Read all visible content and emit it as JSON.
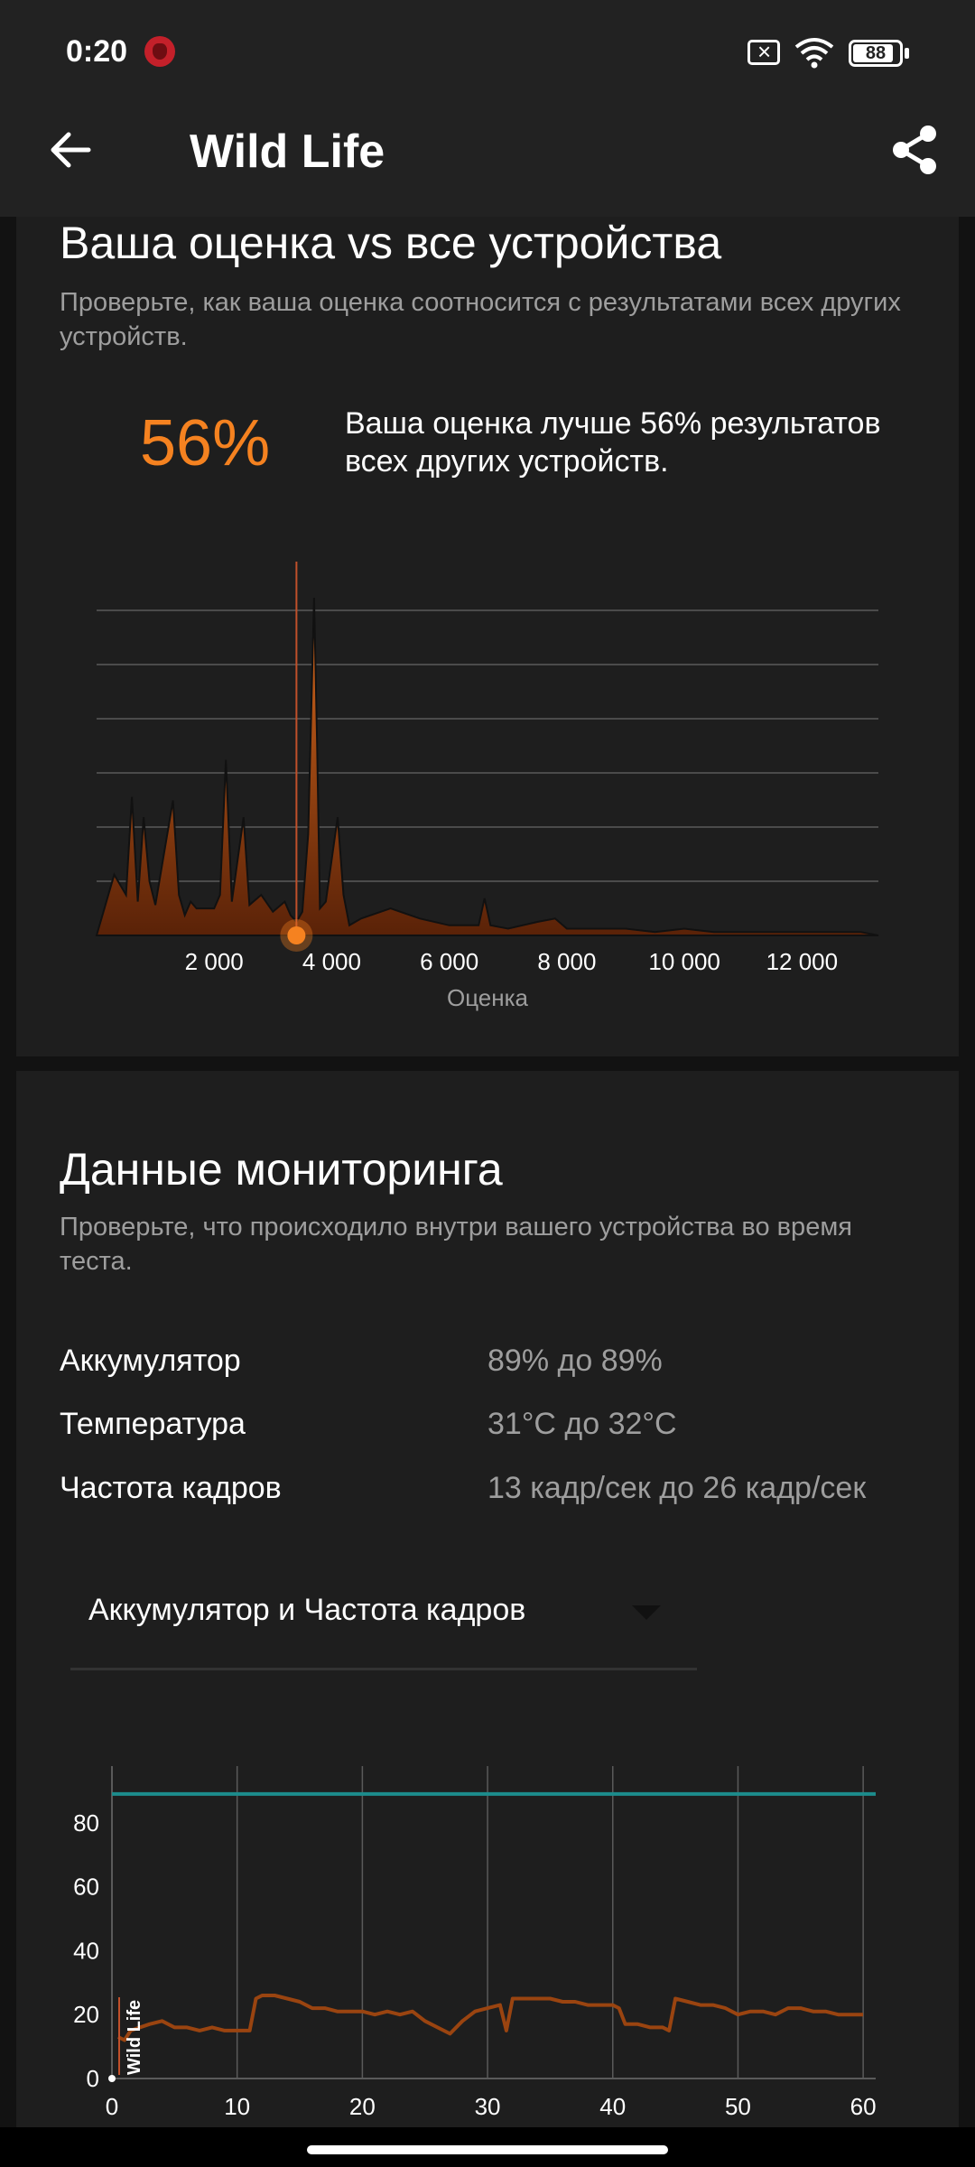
{
  "status_bar": {
    "time": "0:20",
    "battery_level": "88"
  },
  "app_bar": {
    "title": "Wild Life"
  },
  "comparison": {
    "title": "Ваша оценка vs все устройства",
    "subtitle": "Проверьте, как ваша оценка соотносится с результатами всех других устройств.",
    "percent": "56%",
    "description": "Ваша оценка лучше 56% результатов всех других устройств."
  },
  "monitoring": {
    "title": "Данные мониторинга",
    "subtitle": "Проверьте, что происходило внутри вашего устройства во время теста.",
    "rows": [
      {
        "label": "Аккумулятор",
        "value": "89% до 89%"
      },
      {
        "label": "Температура",
        "value": "31°C до 32°C"
      },
      {
        "label": "Частота кадров",
        "value": "13 кадр/сек до 26 кадр/сек"
      }
    ],
    "dropdown_selected": "Аккумулятор и Частота кадров"
  },
  "colors": {
    "accent": "#f58220",
    "battery_line": "#1c8c8c",
    "fps_line": "#9a4410",
    "background": "#121212",
    "card": "#1e1e1e"
  },
  "chart_data": [
    {
      "type": "area",
      "xlabel": "Оценка",
      "x_ticks": [
        "2 000",
        "4 000",
        "6 000",
        "8 000",
        "10 000",
        "12 000"
      ],
      "xlim": [
        0,
        13300
      ],
      "marker_score": 3400,
      "marker_percentile": 56,
      "grid": true,
      "x": [
        0,
        100,
        300,
        500,
        600,
        700,
        800,
        900,
        1000,
        1300,
        1400,
        1500,
        1600,
        1700,
        2000,
        2100,
        2200,
        2300,
        2500,
        2600,
        2800,
        3000,
        3200,
        3300,
        3400,
        3500,
        3600,
        3700,
        3750,
        3800,
        3900,
        4100,
        4200,
        4300,
        4500,
        5000,
        5500,
        6000,
        6500,
        6600,
        6700,
        7000,
        7500,
        7800,
        8000,
        8500,
        9000,
        9500,
        10000,
        10500,
        11000,
        12000,
        13000,
        13300
      ],
      "values": [
        0,
        0.06,
        0.18,
        0.12,
        0.41,
        0.1,
        0.35,
        0.16,
        0.09,
        0.4,
        0.12,
        0.06,
        0.1,
        0.08,
        0.08,
        0.12,
        0.52,
        0.1,
        0.35,
        0.09,
        0.12,
        0.07,
        0.1,
        0.06,
        0.04,
        0.07,
        0.3,
        1.0,
        0.57,
        0.08,
        0.1,
        0.35,
        0.12,
        0.03,
        0.05,
        0.08,
        0.05,
        0.03,
        0.03,
        0.11,
        0.03,
        0.02,
        0.04,
        0.05,
        0.02,
        0.02,
        0.02,
        0.01,
        0.02,
        0.01,
        0.01,
        0.01,
        0.01,
        0
      ]
    },
    {
      "type": "line",
      "xlim": [
        0,
        61
      ],
      "ylim": [
        0,
        100
      ],
      "x_ticks": [
        "0",
        "10",
        "20",
        "30",
        "40",
        "50",
        "60"
      ],
      "y_ticks": [
        "0",
        "20",
        "40",
        "60",
        "80"
      ],
      "annotation": "Wild Life",
      "grid": true,
      "series": [
        {
          "values_x": [
            0,
            61
          ],
          "values": [
            89,
            89
          ]
        },
        {
          "values_x": [
            0.5,
            1,
            1.5,
            3,
            4,
            5,
            6,
            7,
            8,
            9,
            10,
            11,
            11.5,
            12,
            13,
            14,
            15,
            16,
            17,
            18,
            19,
            20,
            21,
            22,
            23,
            24,
            25,
            26,
            27,
            28,
            29,
            30,
            31,
            31.5,
            32,
            33,
            34,
            35,
            36,
            37,
            38,
            39,
            40,
            40.5,
            41,
            42,
            43,
            44,
            44.5,
            45,
            46,
            47,
            48,
            49,
            50,
            51,
            52,
            53,
            54,
            55,
            56,
            57,
            58,
            59,
            60
          ],
          "values": [
            13,
            12,
            15,
            17,
            18,
            16,
            16,
            15,
            16,
            15,
            15,
            15,
            25,
            26,
            26,
            25,
            24,
            22,
            22,
            21,
            21,
            21,
            20,
            21,
            20,
            21,
            18,
            16,
            14,
            18,
            21,
            22,
            23,
            15,
            25,
            25,
            25,
            25,
            24,
            24,
            23,
            23,
            23,
            22,
            17,
            17,
            16,
            16,
            15,
            25,
            24,
            23,
            23,
            22,
            20,
            21,
            21,
            20,
            22,
            22,
            21,
            21,
            20,
            20,
            20
          ]
        }
      ]
    }
  ]
}
